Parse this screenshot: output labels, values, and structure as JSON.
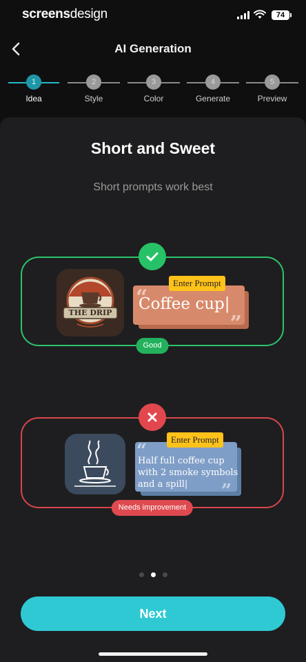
{
  "status": {
    "brand_bold": "screens",
    "brand_regular": "design",
    "battery": "74"
  },
  "header": {
    "title": "AI Generation"
  },
  "steps": [
    {
      "num": "1",
      "label": "Idea"
    },
    {
      "num": "2",
      "label": "Style"
    },
    {
      "num": "3",
      "label": "Color"
    },
    {
      "num": "4",
      "label": "Generate"
    },
    {
      "num": "5",
      "label": "Preview"
    }
  ],
  "active_step": 1,
  "content": {
    "title": "Short and Sweet",
    "subtitle": "Short prompts work best"
  },
  "good_example": {
    "status_icon": "check-icon",
    "logo_text": "THE DRIP",
    "prompt_tag": "Enter Prompt",
    "prompt_text": "Coffee cup|",
    "label": "Good",
    "colors": {
      "border": "#2ec56b",
      "card": "#d78a6b"
    }
  },
  "bad_example": {
    "status_icon": "x-icon",
    "prompt_tag": "Enter Prompt",
    "prompt_text": "Half full coffee cup with 2 smoke symbols and a spill|",
    "label": "Needs improvement",
    "colors": {
      "border": "#d8474c",
      "card": "#7f9ec7"
    }
  },
  "pagination": {
    "count": 3,
    "active": 2
  },
  "footer": {
    "next_label": "Next"
  },
  "colors": {
    "accent": "#2fc9d4",
    "background": "#0f0f10",
    "panel": "#1e1e20"
  }
}
